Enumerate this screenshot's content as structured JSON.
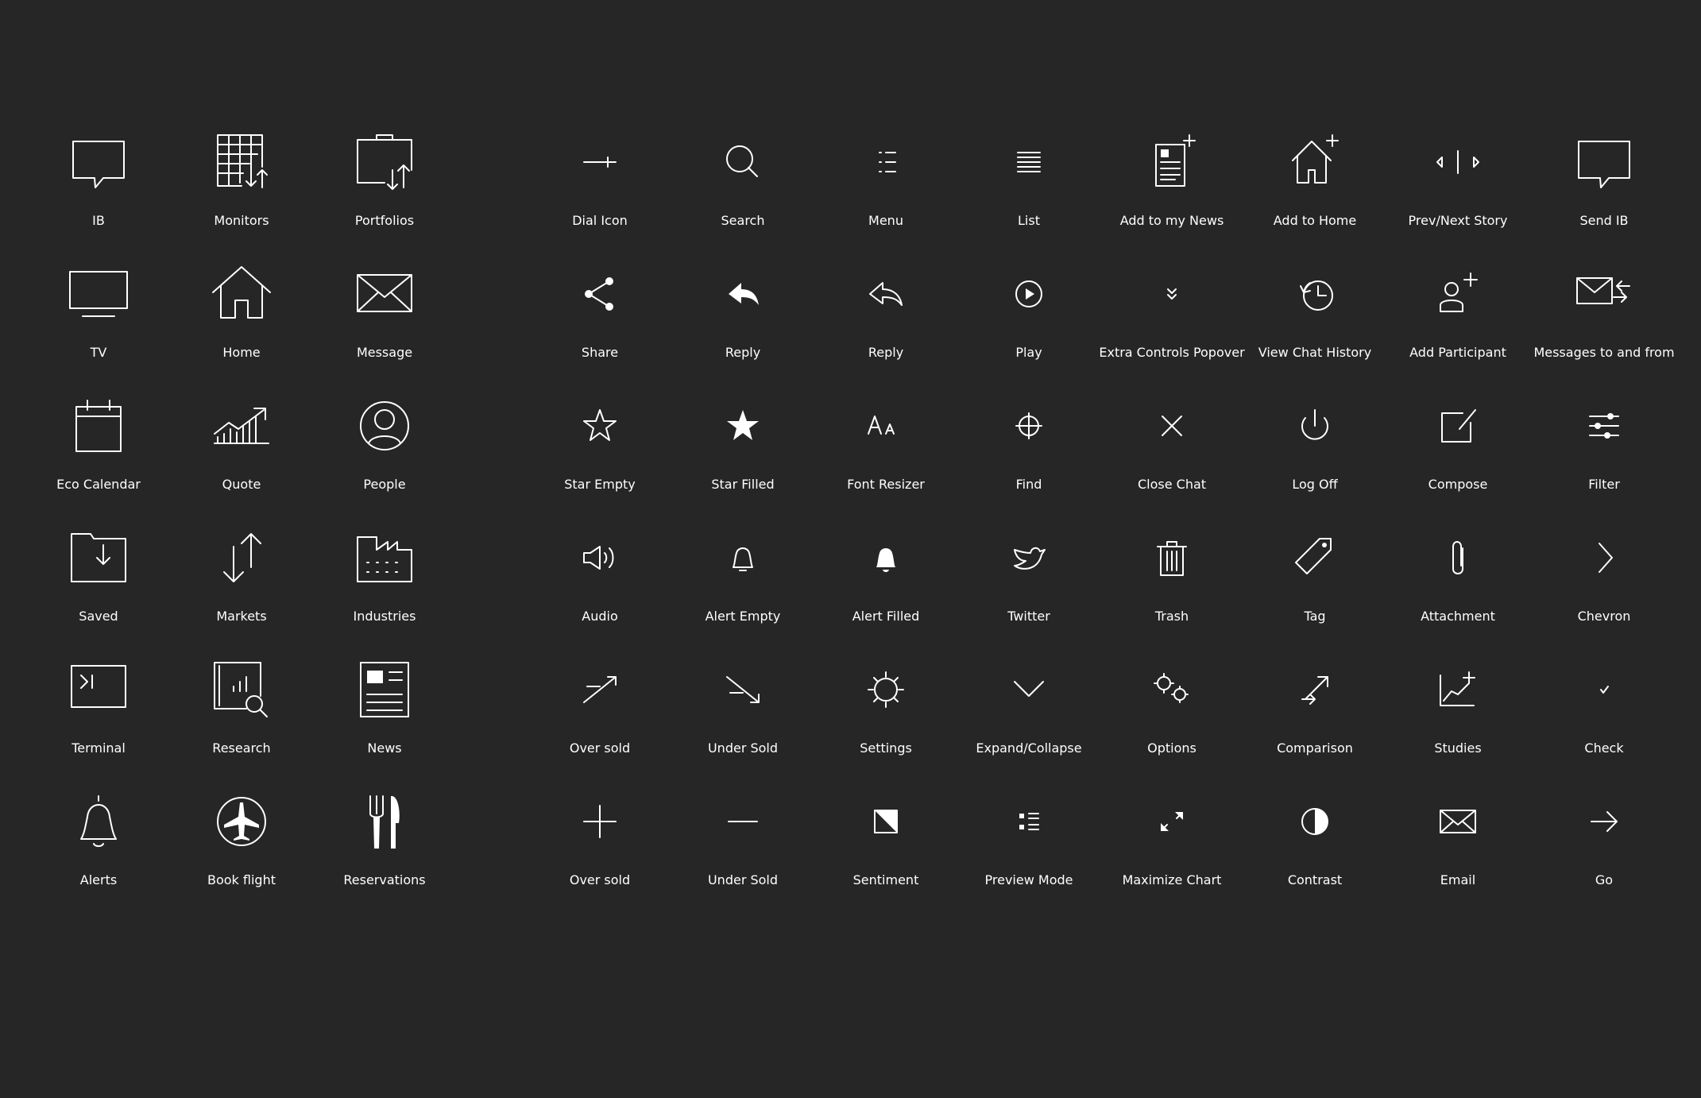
{
  "colors": {
    "background": "#262626",
    "icon": "#ffffff",
    "text": "#ffffff"
  },
  "icons": [
    {
      "label": "IB",
      "icon": "speech-bubble-icon"
    },
    {
      "label": "Monitors",
      "icon": "grid-arrows-icon"
    },
    {
      "label": "Portfolios",
      "icon": "briefcase-arrows-icon"
    },
    {
      "label": "Dial Icon",
      "icon": "dial-icon"
    },
    {
      "label": "Search",
      "icon": "search-icon"
    },
    {
      "label": "Menu",
      "icon": "menu-icon"
    },
    {
      "label": "List",
      "icon": "list-icon"
    },
    {
      "label": "Add to my News",
      "icon": "add-news-icon"
    },
    {
      "label": "Add to Home",
      "icon": "add-home-icon"
    },
    {
      "label": "Prev/Next Story",
      "icon": "prev-next-icon"
    },
    {
      "label": "Send IB",
      "icon": "send-ib-icon"
    },
    {
      "label": "TV",
      "icon": "tv-icon"
    },
    {
      "label": "Home",
      "icon": "home-icon"
    },
    {
      "label": "Message",
      "icon": "envelope-icon"
    },
    {
      "label": "Share",
      "icon": "share-icon"
    },
    {
      "label": "Reply",
      "icon": "reply-filled-icon"
    },
    {
      "label": "Reply",
      "icon": "reply-outline-icon"
    },
    {
      "label": "Play",
      "icon": "play-icon"
    },
    {
      "label": "Extra Controls Popover",
      "icon": "double-chevron-down-icon"
    },
    {
      "label": "View Chat History",
      "icon": "clock-history-icon"
    },
    {
      "label": "Add Participant",
      "icon": "add-participant-icon"
    },
    {
      "label": "Messages to and from",
      "icon": "messages-to-from-icon"
    },
    {
      "label": "Eco Calendar",
      "icon": "calendar-icon"
    },
    {
      "label": "Quote",
      "icon": "quote-chart-icon"
    },
    {
      "label": "People",
      "icon": "person-circle-icon"
    },
    {
      "label": "Star Empty",
      "icon": "star-empty-icon"
    },
    {
      "label": "Star Filled",
      "icon": "star-filled-icon"
    },
    {
      "label": "Font Resizer",
      "icon": "font-resizer-icon"
    },
    {
      "label": "Find",
      "icon": "crosshair-icon"
    },
    {
      "label": "Close Chat",
      "icon": "close-icon"
    },
    {
      "label": "Log Off",
      "icon": "power-icon"
    },
    {
      "label": "Compose",
      "icon": "compose-icon"
    },
    {
      "label": "Filter",
      "icon": "filter-sliders-icon"
    },
    {
      "label": "Saved",
      "icon": "folder-download-icon"
    },
    {
      "label": "Markets",
      "icon": "up-down-arrows-icon"
    },
    {
      "label": "Industries",
      "icon": "factory-icon"
    },
    {
      "label": "Audio",
      "icon": "speaker-icon"
    },
    {
      "label": "Alert Empty",
      "icon": "bell-outline-icon"
    },
    {
      "label": "Alert Filled",
      "icon": "bell-filled-icon"
    },
    {
      "label": "Twitter",
      "icon": "twitter-bird-icon"
    },
    {
      "label": "Trash",
      "icon": "trash-icon"
    },
    {
      "label": "Tag",
      "icon": "tag-icon"
    },
    {
      "label": "Attachment",
      "icon": "paperclip-icon"
    },
    {
      "label": "Chevron",
      "icon": "chevron-right-icon"
    },
    {
      "label": "Terminal",
      "icon": "terminal-icon"
    },
    {
      "label": "Research",
      "icon": "research-icon"
    },
    {
      "label": "News",
      "icon": "newspaper-icon"
    },
    {
      "label": "Over sold",
      "icon": "trend-up-icon"
    },
    {
      "label": "Under Sold",
      "icon": "trend-down-icon"
    },
    {
      "label": "Settings",
      "icon": "gear-icon"
    },
    {
      "label": "Expand/Collapse",
      "icon": "chevron-down-icon"
    },
    {
      "label": "Options",
      "icon": "gears-icon"
    },
    {
      "label": "Comparison",
      "icon": "comparison-arrows-icon"
    },
    {
      "label": "Studies",
      "icon": "studies-chart-icon"
    },
    {
      "label": "Check",
      "icon": "check-icon"
    },
    {
      "label": "Alerts",
      "icon": "bell-icon"
    },
    {
      "label": "Book flight",
      "icon": "airplane-icon"
    },
    {
      "label": "Reservations",
      "icon": "fork-knife-icon"
    },
    {
      "label": "Over sold",
      "icon": "plus-icon"
    },
    {
      "label": "Under Sold",
      "icon": "minus-icon"
    },
    {
      "label": "Sentiment",
      "icon": "sentiment-icon"
    },
    {
      "label": "Preview Mode",
      "icon": "preview-list-icon"
    },
    {
      "label": "Maximize Chart",
      "icon": "maximize-icon"
    },
    {
      "label": "Contrast",
      "icon": "contrast-icon"
    },
    {
      "label": "Email",
      "icon": "email-icon"
    },
    {
      "label": "Go",
      "icon": "arrow-right-icon"
    }
  ]
}
